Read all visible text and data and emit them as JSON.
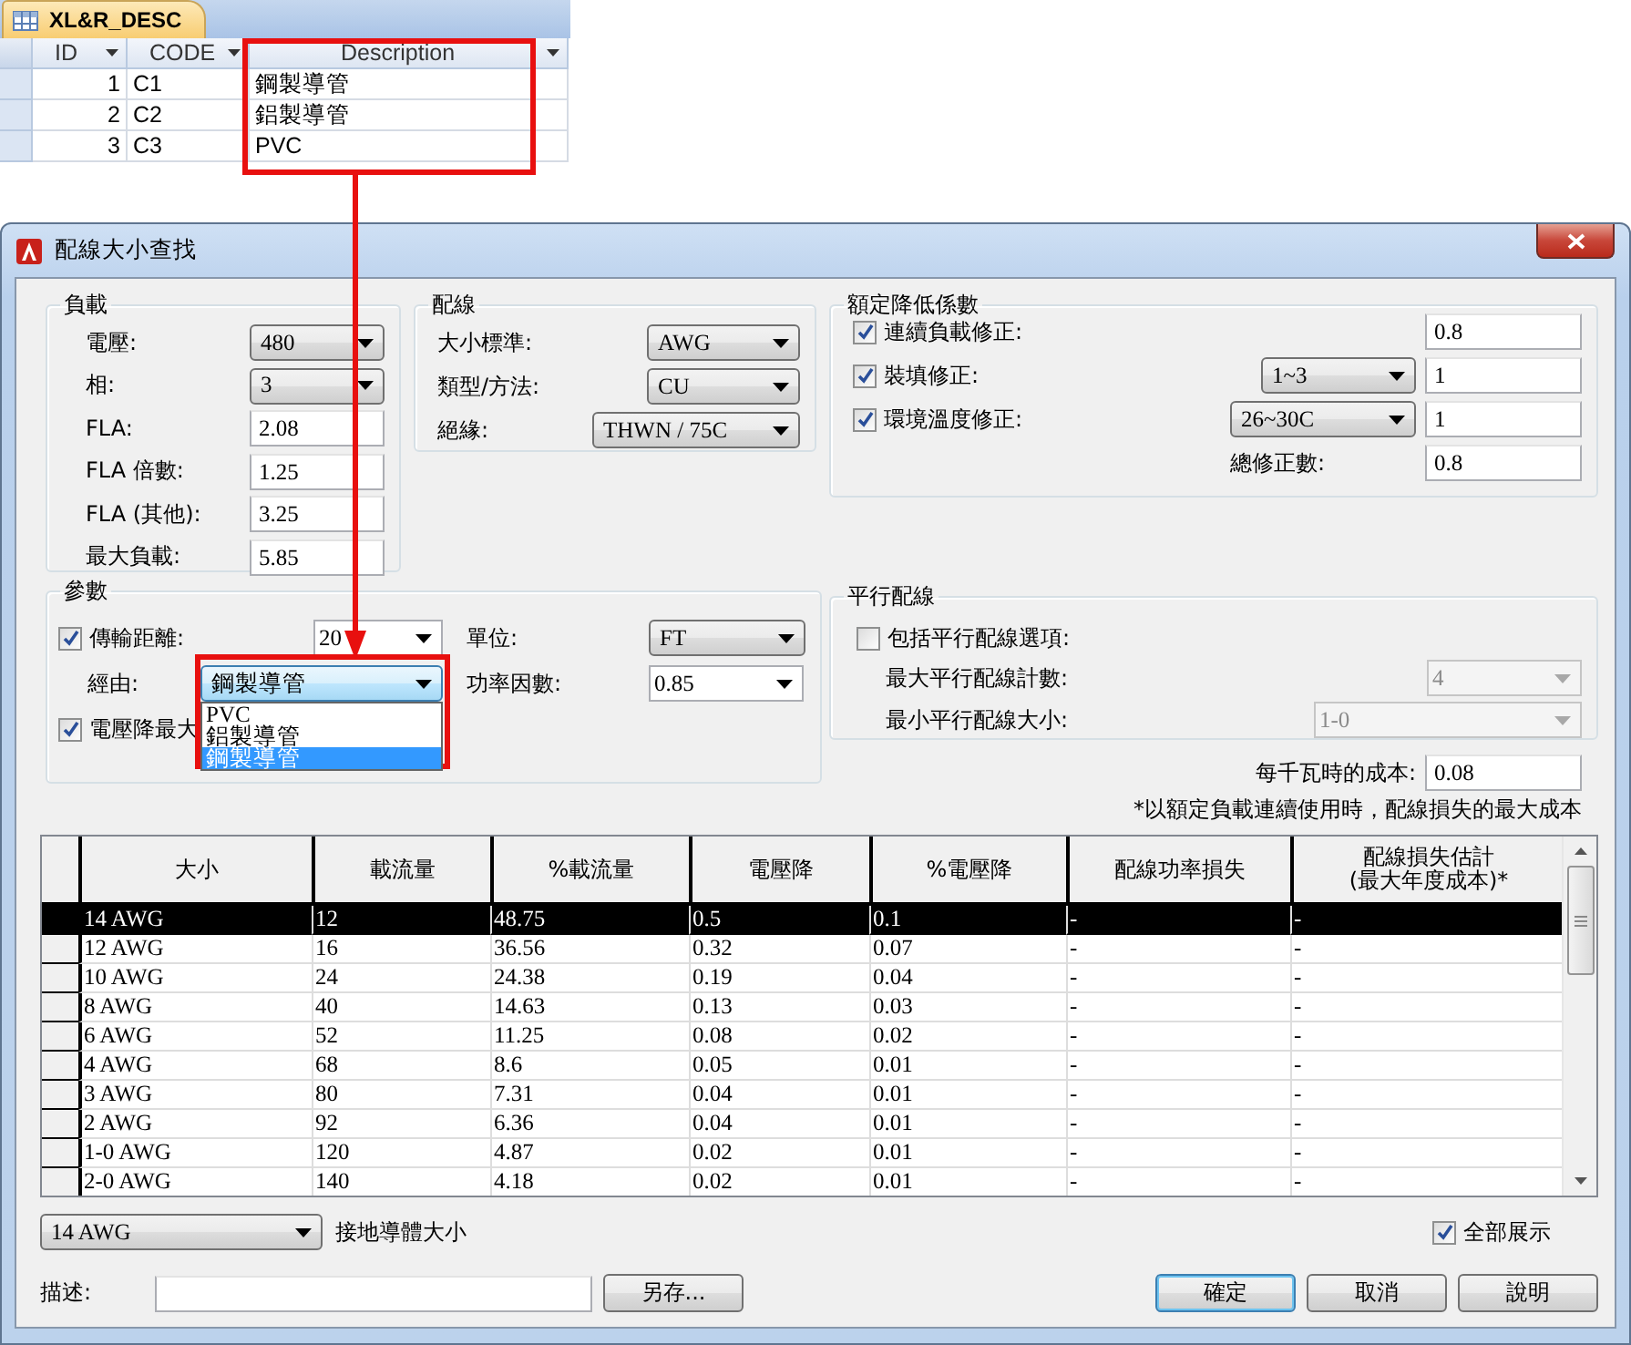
{
  "access_table": {
    "tab": "XL&R_DESC",
    "columns": [
      "ID",
      "CODE",
      "Description"
    ],
    "rows": [
      {
        "id": "1",
        "code": "C1",
        "description": "鋼製導管"
      },
      {
        "id": "2",
        "code": "C2",
        "description": "鋁製導管"
      },
      {
        "id": "3",
        "code": "C3",
        "description": "PVC"
      }
    ]
  },
  "window": {
    "title": "配線大小查找"
  },
  "load": {
    "title": "負載",
    "fields": [
      {
        "label": "電壓:",
        "value": "480",
        "kind": "dropdown"
      },
      {
        "label": "相:",
        "value": "3",
        "kind": "dropdown"
      },
      {
        "label": "FLA:",
        "value": "2.08",
        "kind": "field"
      },
      {
        "label": "FLA 倍數:",
        "value": "1.25",
        "kind": "field"
      },
      {
        "label": "FLA (其他):",
        "value": "3.25",
        "kind": "field"
      },
      {
        "label": "最大負載:",
        "value": "5.85",
        "kind": "field"
      }
    ]
  },
  "wiring": {
    "title": "配線",
    "fields": [
      {
        "label": "大小標準:",
        "value": "AWG"
      },
      {
        "label": "類型/方法:",
        "value": "CU"
      },
      {
        "label": "絕緣:",
        "value": "THWN / 75C"
      }
    ]
  },
  "derating": {
    "title": "額定降低係數",
    "rows": [
      {
        "label": "連續負載修正:",
        "checked": true,
        "value": "0.8"
      },
      {
        "label": "裝填修正:",
        "checked": true,
        "select": "1~3",
        "value": "1"
      },
      {
        "label": "環境溫度修正:",
        "checked": true,
        "select": "26~30C",
        "value": "1"
      }
    ],
    "total_label": "總修正數:",
    "total_value": "0.8"
  },
  "parameters": {
    "title": "參數",
    "distance": {
      "label": "傳輸距離:",
      "checked": true,
      "value": "20"
    },
    "unit": {
      "label": "單位:",
      "value": "FT"
    },
    "route": {
      "label": "經由:",
      "value": "鋼製導管",
      "open": true,
      "options": [
        {
          "label": "PVC",
          "selected": false
        },
        {
          "label": "鋁製導管",
          "selected": false
        },
        {
          "label": "鋼製導管",
          "selected": true
        }
      ]
    },
    "power_factor": {
      "label": "功率因數:",
      "value": "0.85"
    },
    "max_drop": {
      "label": "電壓降最大",
      "checked": true
    }
  },
  "parallel": {
    "title": "平行配線",
    "include": {
      "label": "包括平行配線選項:",
      "checked": false
    },
    "max_count": {
      "label": "最大平行配線計數:",
      "value": "4",
      "disabled": true
    },
    "min_size": {
      "label": "最小平行配線大小:",
      "value": "1-0",
      "disabled": true
    }
  },
  "cost": {
    "label": "每千瓦時的成本:",
    "value": "0.08",
    "note": "*以額定負載連續使用時，配線損失的最大成本"
  },
  "table": {
    "columns": [
      "大小",
      "載流量",
      "%載流量",
      "電壓降",
      "%電壓降",
      "配線功率損失",
      "配線損失估計\n(最大年度成本)*"
    ],
    "rows": [
      {
        "selected": true,
        "cells": [
          "14 AWG",
          "12",
          "48.75",
          "0.5",
          "0.1",
          "-",
          "-"
        ]
      },
      {
        "selected": false,
        "cells": [
          "12 AWG",
          "16",
          "36.56",
          "0.32",
          "0.07",
          "-",
          "-"
        ]
      },
      {
        "selected": false,
        "cells": [
          "10 AWG",
          "24",
          "24.38",
          "0.19",
          "0.04",
          "-",
          "-"
        ]
      },
      {
        "selected": false,
        "cells": [
          "8 AWG",
          "40",
          "14.63",
          "0.13",
          "0.03",
          "-",
          "-"
        ]
      },
      {
        "selected": false,
        "cells": [
          "6 AWG",
          "52",
          "11.25",
          "0.08",
          "0.02",
          "-",
          "-"
        ]
      },
      {
        "selected": false,
        "cells": [
          "4 AWG",
          "68",
          "8.6",
          "0.05",
          "0.01",
          "-",
          "-"
        ]
      },
      {
        "selected": false,
        "cells": [
          "3 AWG",
          "80",
          "7.31",
          "0.04",
          "0.01",
          "-",
          "-"
        ]
      },
      {
        "selected": false,
        "cells": [
          "2 AWG",
          "92",
          "6.36",
          "0.04",
          "0.01",
          "-",
          "-"
        ]
      },
      {
        "selected": false,
        "cells": [
          "1-0 AWG",
          "120",
          "4.87",
          "0.02",
          "0.01",
          "-",
          "-"
        ]
      },
      {
        "selected": false,
        "cells": [
          "2-0 AWG",
          "140",
          "4.18",
          "0.02",
          "0.01",
          "-",
          "-"
        ]
      }
    ]
  },
  "ground": {
    "value": "14 AWG",
    "label": "接地導體大小"
  },
  "show_all": {
    "label": "全部展示",
    "checked": true
  },
  "description": {
    "label": "描述:"
  },
  "save_button": {
    "label": "另存..."
  },
  "buttons": [
    {
      "label": "確定",
      "default": true
    },
    {
      "label": "取消",
      "default": false
    },
    {
      "label": "說明",
      "default": false
    }
  ]
}
